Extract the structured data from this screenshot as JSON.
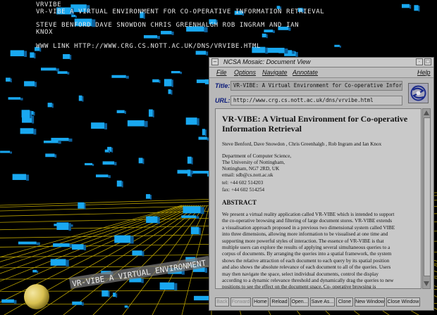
{
  "world": {
    "heading_lines": [
      "VRVIBE",
      "VR-VIBE  A VIRTUAL ENVIRONMENT FOR CO-OPERATIVE INFORMATION RETRIEVAL",
      "STEVE BENFORD  DAVE SNOWDON  CHRIS GREENHALGH  ROB INGRAM AND IAN",
      "KNOX",
      "WWW LINK HTTP://WWW.CRG.CS.NOTT.AC.UK/DNS/VRVIBE.HTML"
    ],
    "floor_banner": "VR-VIBE  A VIRTUAL ENVIRONMENT FOR",
    "colors": {
      "background": "#000000",
      "grid": "#b8a000",
      "blocks": "#19a8f0",
      "sphere": "#d8c050"
    }
  },
  "window": {
    "title": "NCSA Mosaic: Document View",
    "menu": [
      "File",
      "Options",
      "Navigate",
      "Annotate"
    ],
    "help": "Help",
    "title_label": "Title:",
    "title_value": "VR-VIBE: A Virtual Environment for Co-operative Information",
    "url_label": "URL:",
    "url_value": "http://www.crg.cs.nott.ac.uk/dns/vrvibe.html",
    "logo_icon": "ncsa-globe-icon",
    "doc": {
      "heading": "VR-VIBE: A Virtual Environment for Co-operative Information Retrieval",
      "authors": "Steve Benford, Dave Snowdon , Chris Greenhalgh , Rob Ingram and Ian Knox",
      "address": [
        "Department of Computer Science,",
        "The University of Nottingham,",
        "Nottingham, NG7 2RD, UK",
        "email: sdb@cs.nott.ac.uk",
        "tel: +44 602 514203",
        "fax: +44 602 514254"
      ],
      "abstract_heading": "ABSTRACT",
      "abstract_lines": [
        "We present a virtual reality application called VR-VIBE which is intended to support",
        "the co-operative browsing and filtering of large document stores. VR-VIBE extends",
        "a visualisation approach proposed in a previous two dimensional system called VIBE",
        "into three dimensions, allowing more information to be visualised at one time and",
        "supporting more powerful styles of interaction. The essence of VR-VIBE is that",
        "multiple users can explore the results of applying several simultaneous queries to a",
        "corpus of documents. By arranging the queries into a spatial framework, the system",
        "shows the relative attraction of each document to each query by its spatial position",
        "and also shows the absolute relevance of each document to all of the queries. Users",
        "may then navigate the space, select individual documents, control the display",
        "according to a dynamic relevance threshold and dynamically drag the queries to new",
        "positions to see the effect on the document space. Co- operative browsing is"
      ]
    },
    "buttons": [
      {
        "label": "Back",
        "enabled": false
      },
      {
        "label": "Forward",
        "enabled": false
      },
      {
        "label": "Home",
        "enabled": true
      },
      {
        "label": "Reload",
        "enabled": true
      },
      {
        "label": "Open...",
        "enabled": true
      },
      {
        "label": "Save As...",
        "enabled": true
      },
      {
        "label": "Clone",
        "enabled": true
      },
      {
        "label": "New Window",
        "enabled": true
      },
      {
        "label": "Close Window",
        "enabled": true
      }
    ]
  }
}
